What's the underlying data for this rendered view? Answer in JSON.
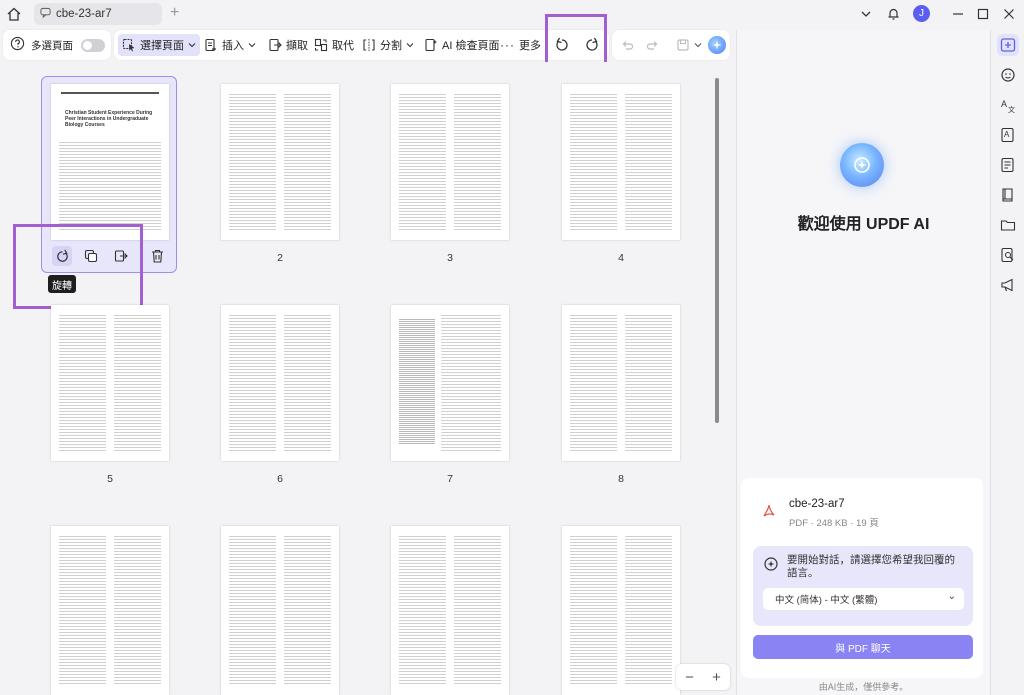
{
  "tab": {
    "title": "cbe-23-ar7"
  },
  "user": {
    "initial": "J"
  },
  "toolbar": {
    "multi_select_label": "多選頁面",
    "select_pages_label": "選擇頁面",
    "insert_label": "插入",
    "extract_label": "擷取",
    "replace_label": "取代",
    "split_label": "分割",
    "ai_check_label": "AI 檢查頁面",
    "more_label": "更多"
  },
  "page_tooltip": "旋轉",
  "pages": [
    "2",
    "3",
    "4",
    "5",
    "6",
    "7",
    "8"
  ],
  "first_page_title": "Christian Student Experience During Peer Interactions in Undergraduate Biology Courses",
  "ai_panel": {
    "welcome": "歡迎使用 UPDF AI",
    "file_name": "cbe-23-ar7",
    "file_meta": "PDF · 248 KB · 19 頁",
    "language_prompt": "要開始對話，請選擇您希望我回覆的語言。",
    "language_selected": "中文 (简体) - 中文 (繁體)",
    "chat_button": "與 PDF 聊天",
    "footer": "由AI生成，僅供參考。"
  },
  "colors": {
    "accent": "#8a83f4",
    "highlight": "#a35fd0",
    "selection": "#e8e6fb"
  }
}
